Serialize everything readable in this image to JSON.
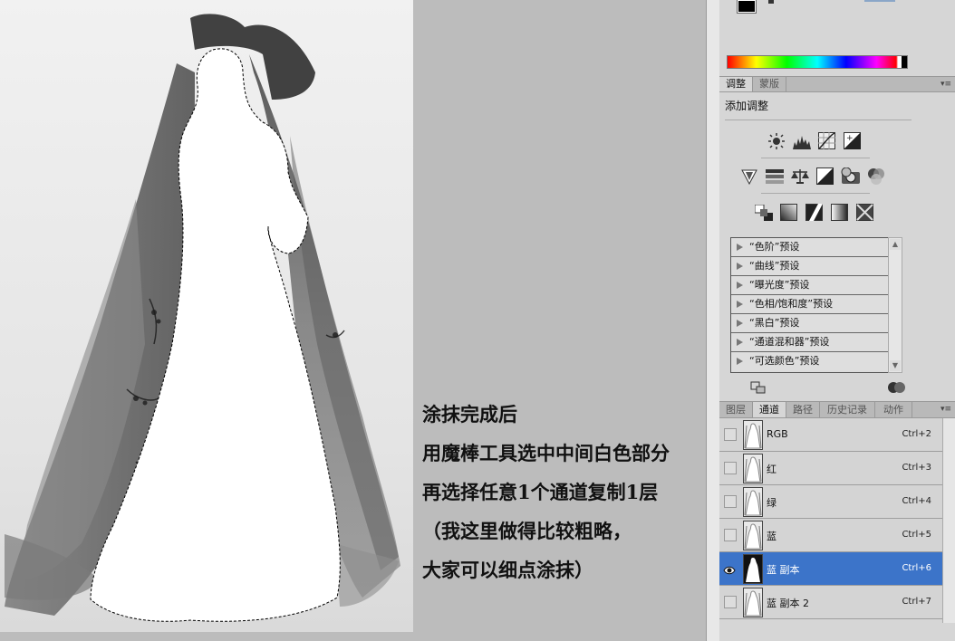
{
  "tutorial_lines": [
    "涂抹完成后",
    "用魔棒工具选中中间白色部分",
    "再选择任意1个通道复制1层",
    "（我这里做得比较粗略，",
    "大家可以细点涂抹）"
  ],
  "adjustments_panel": {
    "tabs": [
      "调整",
      "蒙版"
    ],
    "title": "添加调整",
    "presets": [
      "“色阶”预设",
      "“曲线”预设",
      "“曝光度”预设",
      "“色相/饱和度”预设",
      "“黑白”预设",
      "“通道混和器”预设",
      "“可选颜色”预设"
    ]
  },
  "layers_panel": {
    "tabs": [
      "图层",
      "通道",
      "路径",
      "历史记录",
      "动作"
    ],
    "active_tab": "通道",
    "channels": [
      {
        "name": "RGB",
        "shortcut": "Ctrl+2",
        "visible": false,
        "selected": false
      },
      {
        "name": "红",
        "shortcut": "Ctrl+3",
        "visible": false,
        "selected": false
      },
      {
        "name": "绿",
        "shortcut": "Ctrl+4",
        "visible": false,
        "selected": false
      },
      {
        "name": "蓝",
        "shortcut": "Ctrl+5",
        "visible": false,
        "selected": false
      },
      {
        "name": "蓝 副本",
        "shortcut": "Ctrl+6",
        "visible": true,
        "selected": true
      },
      {
        "name": "蓝 副本 2",
        "shortcut": "Ctrl+7",
        "visible": false,
        "selected": false
      }
    ]
  },
  "colors": {
    "selection_blue": "#3c74c9",
    "workspace_gray": "#bcbcbc",
    "panel_gray": "#d6d6d6"
  }
}
